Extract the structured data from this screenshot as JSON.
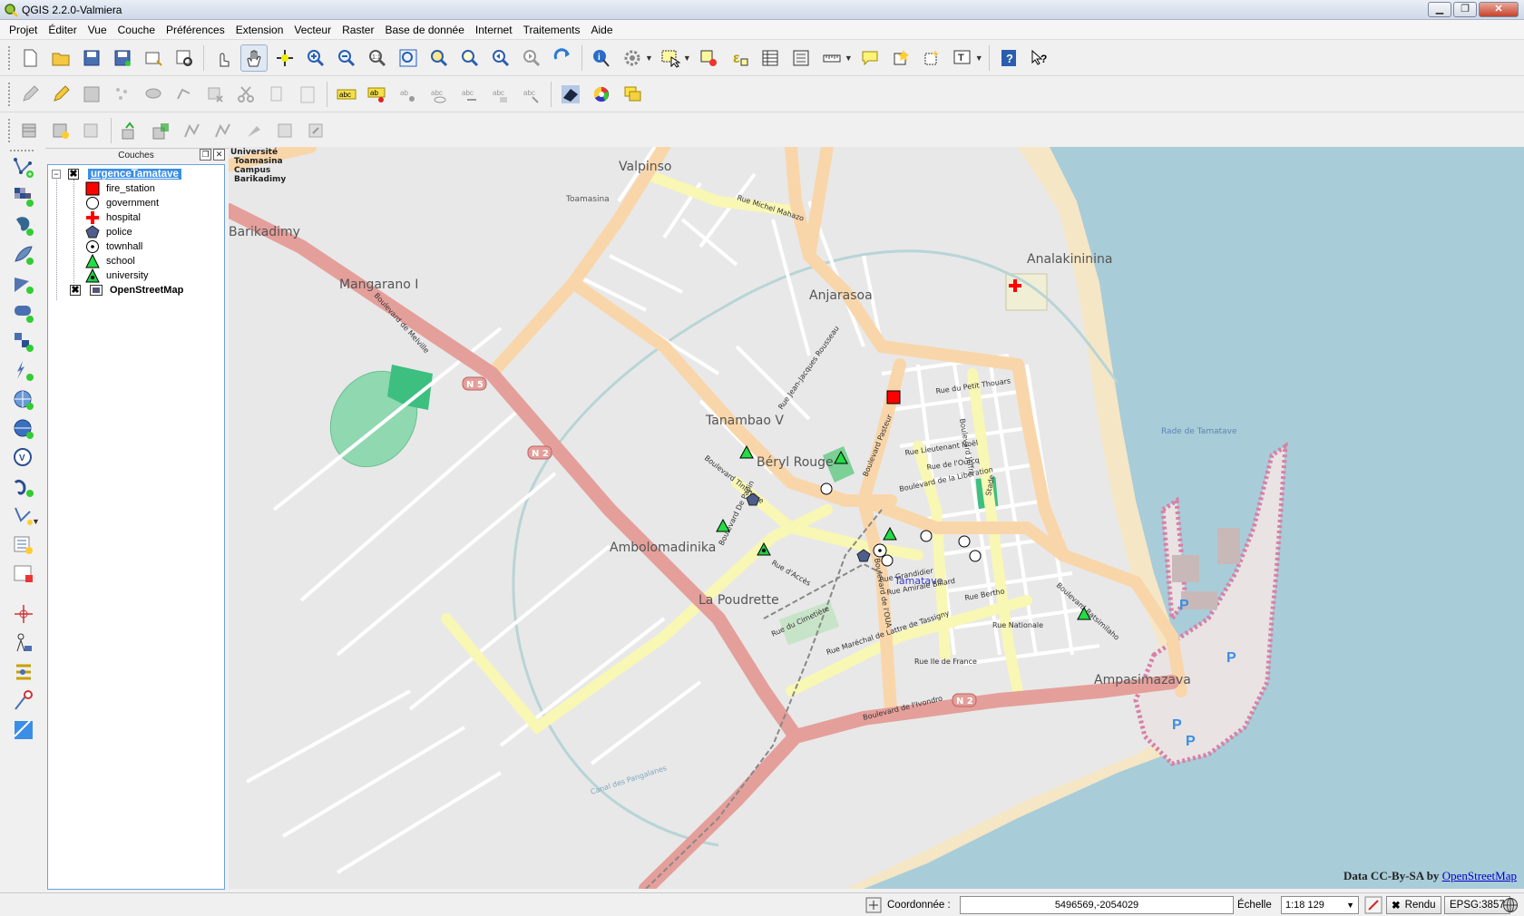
{
  "window": {
    "title": "QGIS 2.2.0-Valmiera",
    "buttons": {
      "minimize": "▁",
      "maximize": "❐",
      "close": "✕"
    }
  },
  "menubar": {
    "items": [
      "Projet",
      "Éditer",
      "Vue",
      "Couche",
      "Préférences",
      "Extension",
      "Vecteur",
      "Raster",
      "Base de donnée",
      "Internet",
      "Traitements",
      "Aide"
    ]
  },
  "toolbars": {
    "row1": [
      "new-project-icon",
      "open-project-icon",
      "save-project-icon",
      "save-as-icon",
      "print-composer-icon",
      "composer-manager-icon",
      "touch-icon",
      "pan-icon",
      "pan-to-selection-icon",
      "zoom-in-icon",
      "zoom-out-icon",
      "zoom-actual-icon",
      "zoom-full-icon",
      "zoom-layer-icon",
      "zoom-selection-icon",
      "zoom-last-icon",
      "zoom-next-icon",
      "refresh-icon",
      "identify-icon",
      "action-icon",
      "select-icon",
      "deselect-icon",
      "expression-select-icon",
      "attribute-table-icon",
      "field-calculator-icon",
      "measure-icon",
      "map-tip-icon",
      "bookmark-new-icon",
      "bookmark-icon",
      "text-annotation-icon",
      "help-icon",
      "whats-this-icon"
    ],
    "row2": [
      "edit-toggle-icon",
      "pencil-icon",
      "save-edits-icon",
      "add-feature-icon",
      "move-feature-icon",
      "node-tool-icon",
      "delete-selected-icon",
      "cut-icon",
      "copy-icon",
      "paste-icon",
      "label-icon",
      "pin-label-icon",
      "show-hide-label-icon",
      "move-label-icon",
      "rotate-label-icon",
      "change-label-icon",
      "label-tool-icon",
      "raster-icon",
      "color-wheel-icon",
      "multi-layer-icon"
    ],
    "row3": [
      "db-icon-1",
      "db-icon-2",
      "db-icon-3",
      "spatial-1",
      "spatial-2",
      "spatial-3",
      "spatial-4",
      "spatial-5",
      "spatial-6",
      "spatial-7"
    ]
  },
  "left_toolbar": [
    "add-vector-layer-icon",
    "add-raster-layer-icon",
    "add-postgis-layer-icon",
    "add-spatialite-layer-icon",
    "add-mssql-layer-icon",
    "add-oracle-layer-icon",
    "add-wms-layer-icon",
    "add-wcs-layer-icon",
    "add-wfs-layer-icon",
    "add-delimited-layer-icon",
    "new-shapefile-icon",
    "new-spatialite-icon",
    "new-temp-layer-icon",
    "remove-layer-icon",
    "gps-icon",
    "node-icon",
    "plugin-icon",
    "georef-icon",
    "zoom-box-icon"
  ],
  "layers_panel": {
    "title": "Couches",
    "group_name": "urgenceTamatave",
    "categories": [
      "fire_station",
      "government",
      "hospital",
      "police",
      "townhall",
      "school",
      "university"
    ],
    "basemap_name": "OpenStreetMap",
    "group_checked": "✖",
    "basemap_checked": "✖"
  },
  "map": {
    "place_labels": [
      "Valpinso",
      "Toamasina",
      "Barikadimy",
      "Mangarano I",
      "Anjarasoa",
      "Analakininina",
      "Tanambao V",
      "Béryl Rouge",
      "Ambolomadinika",
      "La Poudrette",
      "Ampasimazava",
      "Tamatave",
      "Rade de Tamatave"
    ],
    "university_label_lines": [
      "Université",
      "Toamasina",
      "Campus",
      "Barikadimy"
    ],
    "street_labels": [
      "Rue Michel Mahazo",
      "Boulevard de Melville",
      "Boulevard Pasteur",
      "Boulevard de la Libération",
      "Boulevard de l'OUA",
      "Boulevard de l'Ivondro",
      "Boulevard Ratsimilaho",
      "Rue Maréchal de Lattre de Tassigny",
      "Boulevard De Papin",
      "Rue du Petit Thouars",
      "Rue Lieutenant Noël",
      "Rue de l'Ourcq",
      "Rue Grandidier",
      "Rue Amirale Billard",
      "Rue Bertho",
      "Rue Nationale",
      "Rue Ile de France",
      "Rue Jean-Jacques Rousseau",
      "Boulevard Joffre",
      "Rue d'Accès",
      "Rue du Cimetière",
      "Boulevard Tintingue",
      "Canal des Pangalanes",
      "Stade",
      "N 5",
      "N 2"
    ],
    "attribution_prefix": "Data CC-By-SA by",
    "attribution_link": "OpenStreetMap"
  },
  "statusbar": {
    "coord_label": "Coordonnée :",
    "coord_value": "5496569,-2054029",
    "scale_label": "Échelle",
    "scale_value": "1:18 129",
    "render_label": "Rendu",
    "crs": "EPSG:3857"
  },
  "colors": {
    "fire_station": "#ff0000",
    "hospital": "#ff0000",
    "police": "#4d5e8c",
    "school": "#22dd44",
    "university": "#22cc44",
    "sea": "#a9ccd9",
    "primary_road": "#e49f9a",
    "secondary_road": "#f9d6aa",
    "tertiary_road": "#f8f7b4"
  }
}
